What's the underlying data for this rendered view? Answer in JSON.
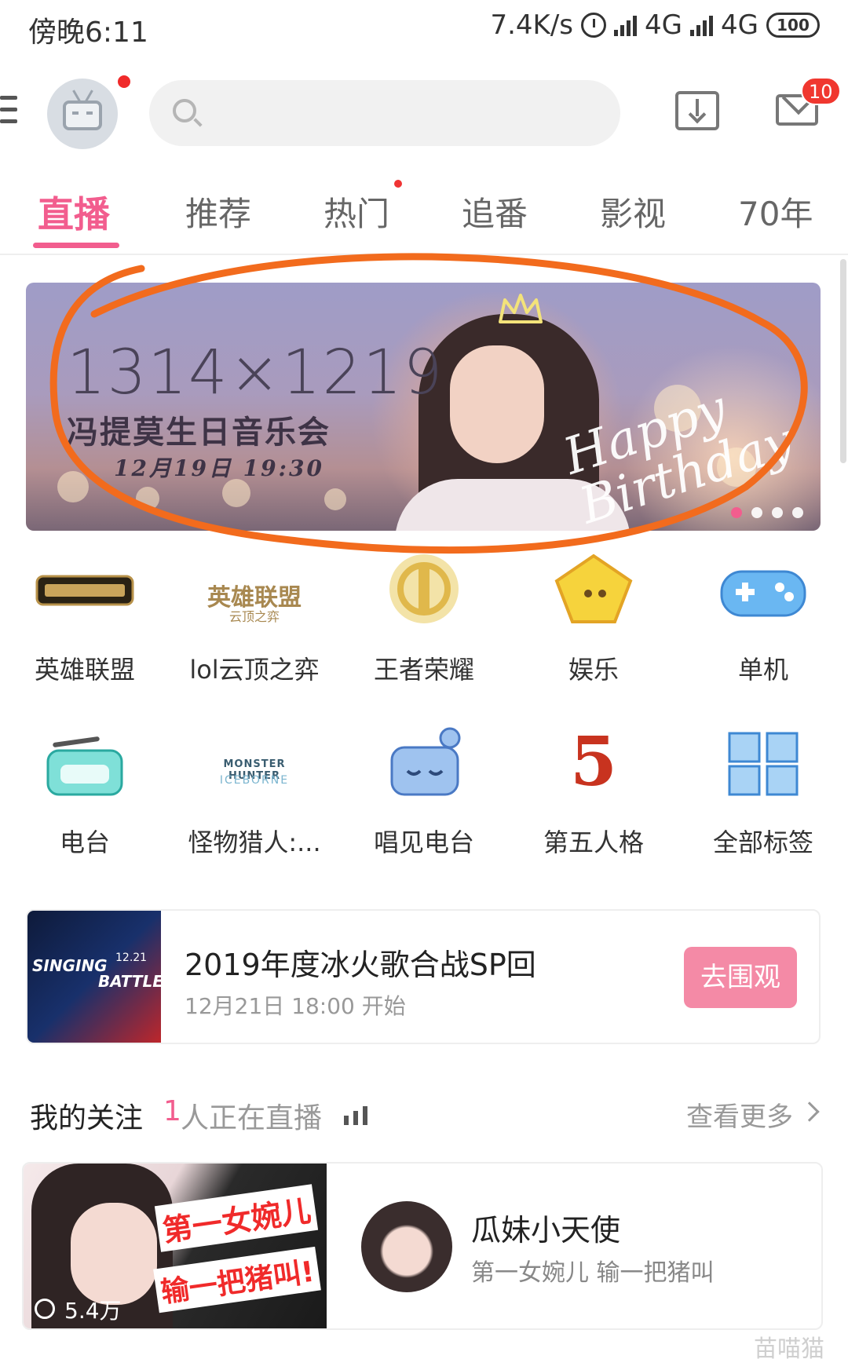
{
  "status_bar": {
    "time": "傍晚6:11",
    "net_speed": "7.4K/s",
    "network1": "4G",
    "network2": "4G",
    "battery": "100",
    "icons": [
      "alarm-icon",
      "signal-icon",
      "battery-icon"
    ]
  },
  "header": {
    "search_placeholder": "",
    "mail_badge": "10",
    "icons": [
      "menu-icon",
      "avatar",
      "search-icon",
      "download-icon",
      "mail-icon"
    ]
  },
  "tabs": [
    {
      "label": "直播",
      "active": true
    },
    {
      "label": "推荐",
      "active": false
    },
    {
      "label": "热门",
      "active": false,
      "dot": true
    },
    {
      "label": "追番",
      "active": false
    },
    {
      "label": "影视",
      "active": false
    },
    {
      "label": "70年",
      "active": false
    }
  ],
  "banner": {
    "title": "1314×1219",
    "subtitle": "冯提莫生日音乐会",
    "date": "12月19日 19:30",
    "script": "Happy Birthday",
    "pages": 4,
    "active_page": 1
  },
  "categories": [
    {
      "label": "英雄联盟",
      "icon": "lol-logo-icon"
    },
    {
      "label": "lol云顶之弈",
      "icon": "tft-logo-icon",
      "logo_text": "英雄联盟",
      "logo_sub": "云顶之弈"
    },
    {
      "label": "王者荣耀",
      "icon": "honor-of-kings-icon"
    },
    {
      "label": "娱乐",
      "icon": "entertainment-icon"
    },
    {
      "label": "单机",
      "icon": "gamepad-icon"
    },
    {
      "label": "电台",
      "icon": "radio-icon"
    },
    {
      "label": "怪物猎人:...",
      "icon": "monster-hunter-icon",
      "logo_text": "MONSTER HUNTER",
      "logo_sub": "ICEBORNE"
    },
    {
      "label": "唱见电台",
      "icon": "singing-radio-icon"
    },
    {
      "label": "第五人格",
      "icon": "identity-v-icon",
      "logo_text": "5"
    },
    {
      "label": "全部标签",
      "icon": "all-tags-icon"
    }
  ],
  "event": {
    "title": "2019年度冰火歌合战SP回",
    "time": "12月21日 18:00 开始",
    "button": "去围观",
    "thumb_text1": "SINGING",
    "thumb_text2": "BATTLE",
    "thumb_text3": "12.21"
  },
  "follow": {
    "title": "我的关注",
    "count": "1",
    "status": "人正在直播",
    "more": "查看更多"
  },
  "stream": {
    "viewers": "5.4万",
    "caption1": "第一女婉儿",
    "caption2": "输一把猪叫!",
    "streamer_name": "瓜妹小天使",
    "room_title": "第一女婉儿 输一把猪叫"
  },
  "watermark": "苗喵猫",
  "colors": {
    "accent": "#f25d8e",
    "annotation": "#f26b1d",
    "button": "#f48aa6"
  }
}
